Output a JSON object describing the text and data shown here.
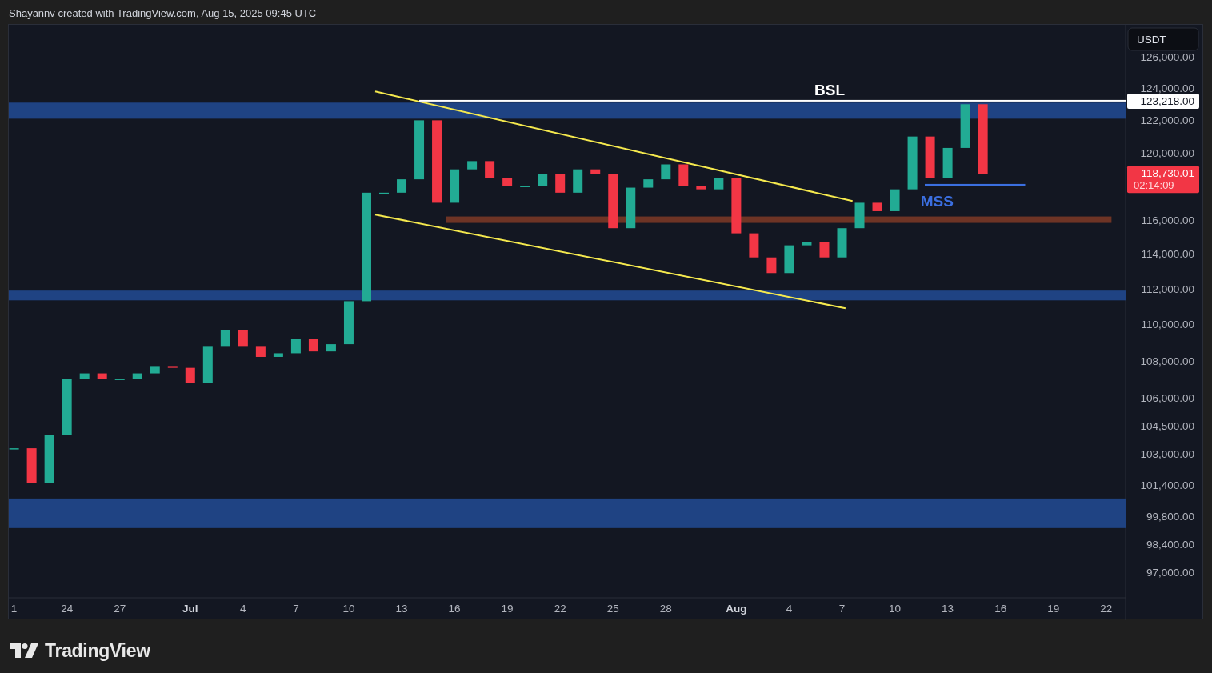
{
  "header": {
    "caption": "Shayannv created with TradingView.com, Aug 15, 2025 09:45 UTC"
  },
  "chart": {
    "currency": "USDT",
    "price_labels": [
      "126,000.00",
      "124,000.00",
      "122,000.00",
      "120,000.00",
      "116,000.00",
      "114,000.00",
      "112,000.00",
      "110,000.00",
      "108,000.00",
      "106,000.00",
      "104,500.00",
      "103,000.00",
      "101,400.00",
      "99,800.00",
      "98,400.00",
      "97,000.00"
    ],
    "time_labels": [
      {
        "text": "1",
        "month": false
      },
      {
        "text": "24",
        "month": false
      },
      {
        "text": "27",
        "month": false
      },
      {
        "text": "Jul",
        "month": true
      },
      {
        "text": "4",
        "month": false
      },
      {
        "text": "7",
        "month": false
      },
      {
        "text": "10",
        "month": false
      },
      {
        "text": "13",
        "month": false
      },
      {
        "text": "16",
        "month": false
      },
      {
        "text": "19",
        "month": false
      },
      {
        "text": "22",
        "month": false
      },
      {
        "text": "25",
        "month": false
      },
      {
        "text": "28",
        "month": false
      },
      {
        "text": "Aug",
        "month": true
      },
      {
        "text": "4",
        "month": false
      },
      {
        "text": "7",
        "month": false
      },
      {
        "text": "10",
        "month": false
      },
      {
        "text": "13",
        "month": false
      },
      {
        "text": "16",
        "month": false
      },
      {
        "text": "19",
        "month": false
      },
      {
        "text": "22",
        "month": false
      }
    ],
    "labels": [
      {
        "kind": "bsl",
        "text": "BSL"
      },
      {
        "kind": "mss",
        "text": "MSS"
      }
    ],
    "price_tags": [
      {
        "kind": "level",
        "text": "123,218.00"
      },
      {
        "kind": "last",
        "text": "118,730.01",
        "countdown": "02:14:09"
      }
    ]
  },
  "footer": {
    "brand": "TradingView"
  }
}
